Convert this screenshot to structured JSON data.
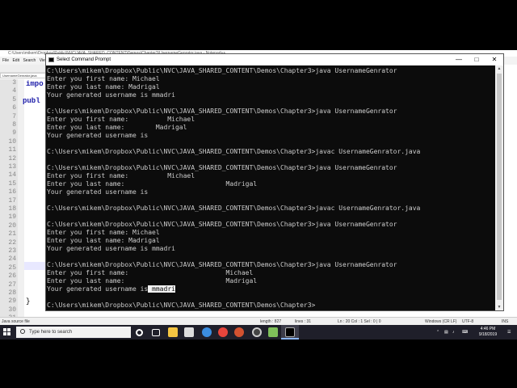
{
  "notepad": {
    "title": "C:\\Users\\mikem\\Dropbox\\Public\\NVC\\JAVA_SHARED_CONTENT\\Demos\\Chapter3\\UsernameGenrator.java - Notepad++",
    "menu": [
      "File",
      "Edit",
      "Search",
      "View"
    ],
    "tab_label": "UsernameGenrator.java",
    "line_numbers": [
      "3",
      "4",
      "5",
      "6",
      "7",
      "8",
      "9",
      "10",
      "11",
      "12",
      "13",
      "14",
      "15",
      "16",
      "17",
      "18",
      "19",
      "20",
      "21",
      "22",
      "23",
      "24",
      "25",
      "26",
      "27",
      "28",
      "29",
      "30",
      "31"
    ],
    "code_fragments": {
      "import": "impo",
      "public": "publ",
      "closing_brace": "}"
    },
    "status": {
      "file_type": "Java source file",
      "length": "length : 827",
      "lines": "lines : 31",
      "position": "Ln : 20   Col : 1   Sel : 0 | 0",
      "eol": "Windows (CR LF)",
      "encoding": "UTF-8",
      "mode": "INS"
    }
  },
  "cmd": {
    "title": "Select Command Prompt",
    "lines": [
      {
        "text": "C:\\Users\\mikem\\Dropbox\\Public\\NVC\\JAVA_SHARED_CONTENT\\Demos\\Chapter3>java UsernameGenrator"
      },
      {
        "text": "Enter you first name: Michael"
      },
      {
        "text": "Enter you last name: Madrigal"
      },
      {
        "text": "Your generated username is mmadri"
      },
      {
        "text": ""
      },
      {
        "text": "C:\\Users\\mikem\\Dropbox\\Public\\NVC\\JAVA_SHARED_CONTENT\\Demos\\Chapter3>java UsernameGenrator"
      },
      {
        "text": "Enter you first name:          Michael"
      },
      {
        "text": "Enter you last name:        Madrigal"
      },
      {
        "text": "Your generated username is"
      },
      {
        "text": ""
      },
      {
        "text": "C:\\Users\\mikem\\Dropbox\\Public\\NVC\\JAVA_SHARED_CONTENT\\Demos\\Chapter3>javac UsernameGenrator.java"
      },
      {
        "text": ""
      },
      {
        "text": "C:\\Users\\mikem\\Dropbox\\Public\\NVC\\JAVA_SHARED_CONTENT\\Demos\\Chapter3>java UsernameGenrator"
      },
      {
        "text": "Enter you first name:          Michael"
      },
      {
        "text": "Enter you last name:                          Madrigal"
      },
      {
        "text": "Your generated username is"
      },
      {
        "text": ""
      },
      {
        "text": "C:\\Users\\mikem\\Dropbox\\Public\\NVC\\JAVA_SHARED_CONTENT\\Demos\\Chapter3>javac UsernameGenrator.java"
      },
      {
        "text": ""
      },
      {
        "text": "C:\\Users\\mikem\\Dropbox\\Public\\NVC\\JAVA_SHARED_CONTENT\\Demos\\Chapter3>java UsernameGenrator"
      },
      {
        "text": "Enter you first name: Michael"
      },
      {
        "text": "Enter you last name: Madrigal"
      },
      {
        "text": "Your generated username is mmadri"
      },
      {
        "text": ""
      },
      {
        "text": "C:\\Users\\mikem\\Dropbox\\Public\\NVC\\JAVA_SHARED_CONTENT\\Demos\\Chapter3>java UsernameGenrator"
      },
      {
        "text": "Enter you first name:                         Michael"
      },
      {
        "text": "Enter you last name:                          Madrigal"
      },
      {
        "text": "Your generated username is",
        "selected": " mmadri"
      },
      {
        "text": ""
      },
      {
        "text": "C:\\Users\\mikem\\Dropbox\\Public\\NVC\\JAVA_SHARED_CONTENT\\Demos\\Chapter3>"
      }
    ]
  },
  "taskbar": {
    "search_placeholder": "Type here to search",
    "time": "4:46 PM",
    "date": "9/18/2019"
  }
}
